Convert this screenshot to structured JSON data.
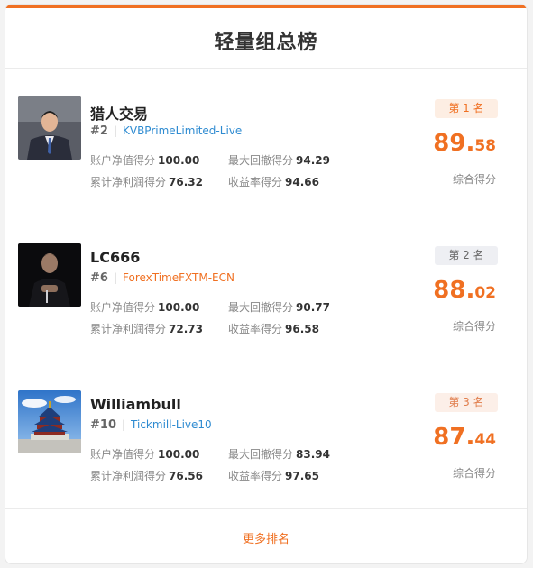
{
  "title": "轻量组总榜",
  "rows": [
    {
      "name": "猎人交易",
      "rank_num": "#2",
      "account": "KVBPrimeLimited-Live",
      "badge": "第 1 名",
      "score_int": "89.",
      "score_dec": "58",
      "score_label": "综合得分",
      "stats": [
        {
          "label": "账户净值得分",
          "value": "100.00"
        },
        {
          "label": "最大回撤得分",
          "value": "94.29"
        },
        {
          "label": "累计净利润得分",
          "value": "76.32"
        },
        {
          "label": "收益率得分",
          "value": "94.66"
        }
      ]
    },
    {
      "name": "LC666",
      "rank_num": "#6",
      "account": "ForexTimeFXTM-ECN",
      "badge": "第 2 名",
      "score_int": "88.",
      "score_dec": "02",
      "score_label": "综合得分",
      "stats": [
        {
          "label": "账户净值得分",
          "value": "100.00"
        },
        {
          "label": "最大回撤得分",
          "value": "90.77"
        },
        {
          "label": "累计净利润得分",
          "value": "72.73"
        },
        {
          "label": "收益率得分",
          "value": "96.58"
        }
      ]
    },
    {
      "name": "Williambull",
      "rank_num": "#10",
      "account": "Tickmill-Live10",
      "badge": "第 3 名",
      "score_int": "87.",
      "score_dec": "44",
      "score_label": "综合得分",
      "stats": [
        {
          "label": "账户净值得分",
          "value": "100.00"
        },
        {
          "label": "最大回撤得分",
          "value": "83.94"
        },
        {
          "label": "累计净利润得分",
          "value": "76.56"
        },
        {
          "label": "收益率得分",
          "value": "97.65"
        }
      ]
    }
  ],
  "more_label": "更多排名",
  "colors": {
    "accent": "#f07022",
    "link_blue": "#2e8bd1"
  }
}
